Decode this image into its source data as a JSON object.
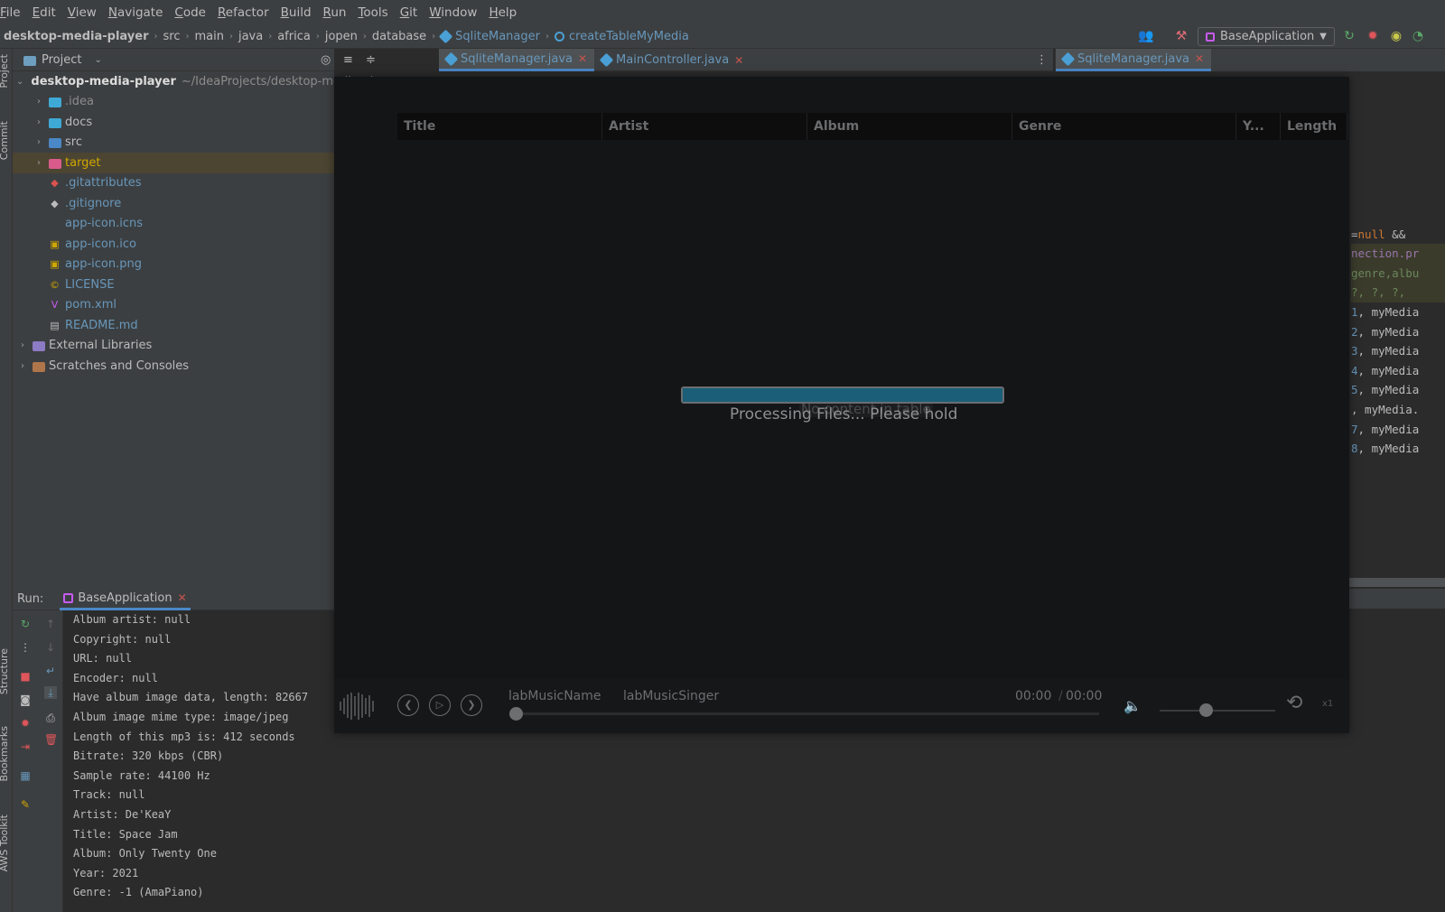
{
  "menu": [
    "File",
    "Edit",
    "View",
    "Navigate",
    "Code",
    "Refactor",
    "Build",
    "Run",
    "Tools",
    "Git",
    "Window",
    "Help"
  ],
  "breadcrumb": {
    "items": [
      "desktop-media-player",
      "src",
      "main",
      "java",
      "africa",
      "jopen",
      "database",
      "SqliteManager",
      "createTableMyMedia"
    ]
  },
  "run_config": {
    "label": "BaseApplication"
  },
  "side_labels": {
    "project": "Project",
    "commit": "Commit",
    "structure": "Structure",
    "bookmarks": "Bookmarks",
    "aws": "AWS Toolkit"
  },
  "project_panel": {
    "title": "Project",
    "root_name": "desktop-media-player",
    "root_path": "~/IdeaProjects/desktop-media-player",
    "items": [
      {
        "label": ".idea",
        "color": "#8c8c8c"
      },
      {
        "label": "docs",
        "color": "#bbbbbb"
      },
      {
        "label": "src",
        "color": "#bbbbbb"
      },
      {
        "label": "target",
        "color": "#d0a700"
      },
      {
        "label": ".gitattributes",
        "color": "#6897bb"
      },
      {
        "label": ".gitignore",
        "color": "#6897bb"
      },
      {
        "label": "app-icon.icns",
        "color": "#6897bb"
      },
      {
        "label": "app-icon.ico",
        "color": "#6897bb"
      },
      {
        "label": "app-icon.png",
        "color": "#6897bb"
      },
      {
        "label": "LICENSE",
        "color": "#6897bb"
      },
      {
        "label": "pom.xml",
        "color": "#6897bb"
      },
      {
        "label": "README.md",
        "color": "#6897bb"
      }
    ],
    "external_libraries": "External Libraries",
    "scratches": "Scratches and Consoles"
  },
  "run_panel": {
    "label": "Run:",
    "tab": "BaseApplication",
    "console_lines": [
      "Album artist: null",
      "Copyright: null",
      "URL: null",
      "Encoder: null",
      "Have album image data, length: 82667",
      "Album image mime type: image/jpeg",
      "Length of this mp3 is: 412 seconds",
      "Bitrate: 320 kbps (CBR)",
      "Sample rate: 44100 Hz",
      "Track: null",
      "Artist: De'KeaY",
      "Title: Space Jam",
      "Album: Only Twenty One",
      "Year: 2021",
      "Genre: -1 (AmaPiano)"
    ]
  },
  "editor_tabs": [
    {
      "label": "SqliteManager.java",
      "active": true
    },
    {
      "label": "MainController.java",
      "active": false
    }
  ],
  "editor_tabs_right": [
    {
      "label": "SqliteManager.java",
      "active": true
    }
  ],
  "code_right": {
    "line1_a": "=",
    "line1_kw": "null",
    "line1_b": " &&",
    "line2": "nection.pr",
    "line3": "genre,albu",
    "line4": "?, ?, ?,",
    "param_lines": [
      {
        "num": "1",
        "rest": ", myMedia"
      },
      {
        "num": "2",
        "rest": ", myMedia"
      },
      {
        "num": "3",
        "rest": ", myMedia"
      },
      {
        "num": "4",
        "rest": ", myMedia"
      },
      {
        "num": "5",
        "rest": ", myMedia"
      },
      {
        "num": "",
        "rest": ", myMedia."
      },
      {
        "num": "7",
        "rest": ", myMedia"
      },
      {
        "num": "8",
        "rest": ", myMedia"
      }
    ]
  },
  "player": {
    "columns": [
      "Title",
      "Artist",
      "Album",
      "Genre",
      "Y...",
      "Length"
    ],
    "empty_message": "No content in table",
    "progress": 1.0,
    "processing_text": "Processing Files... Please hold",
    "track_name": "labMusicName",
    "track_singer": "labMusicSinger",
    "time_current": "00:00",
    "time_separator": "/",
    "time_total": "00:00",
    "seek": 0.0,
    "volume": 0.4,
    "speed": "x1"
  }
}
